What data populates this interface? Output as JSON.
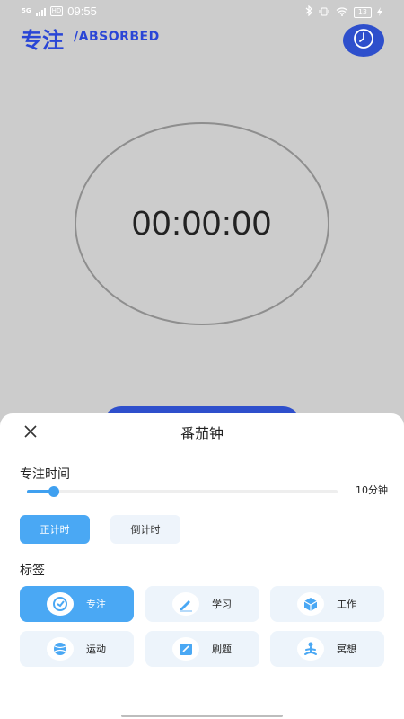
{
  "status_bar": {
    "network": "5G",
    "hd": "HD",
    "time": "09:55",
    "battery": "13",
    "icons": [
      "bluetooth-icon",
      "vibrate-icon",
      "wifi-icon",
      "battery-icon",
      "charging-icon"
    ]
  },
  "header": {
    "title": "专注",
    "subtitle": "/ABSORBED",
    "history_icon": "clock-icon",
    "accent_color": "#2e4fcc"
  },
  "timer": {
    "display": "00:00:00"
  },
  "sheet": {
    "title": "番茄钟",
    "close_icon": "close-icon",
    "focus_time": {
      "label": "专注时间",
      "value_label": "10分钟",
      "slider_fraction": 0.08
    },
    "modes": [
      {
        "label": "正计时",
        "selected": true
      },
      {
        "label": "倒计时",
        "selected": false
      }
    ],
    "tags_label": "标签",
    "tags": [
      {
        "label": "专注",
        "icon": "focus-target-icon",
        "selected": true
      },
      {
        "label": "学习",
        "icon": "pen-icon",
        "selected": false
      },
      {
        "label": "工作",
        "icon": "box-icon",
        "selected": false
      },
      {
        "label": "运动",
        "icon": "ball-icon",
        "selected": false
      },
      {
        "label": "刷题",
        "icon": "edit-note-icon",
        "selected": false
      },
      {
        "label": "冥想",
        "icon": "meditation-icon",
        "selected": false
      }
    ]
  }
}
